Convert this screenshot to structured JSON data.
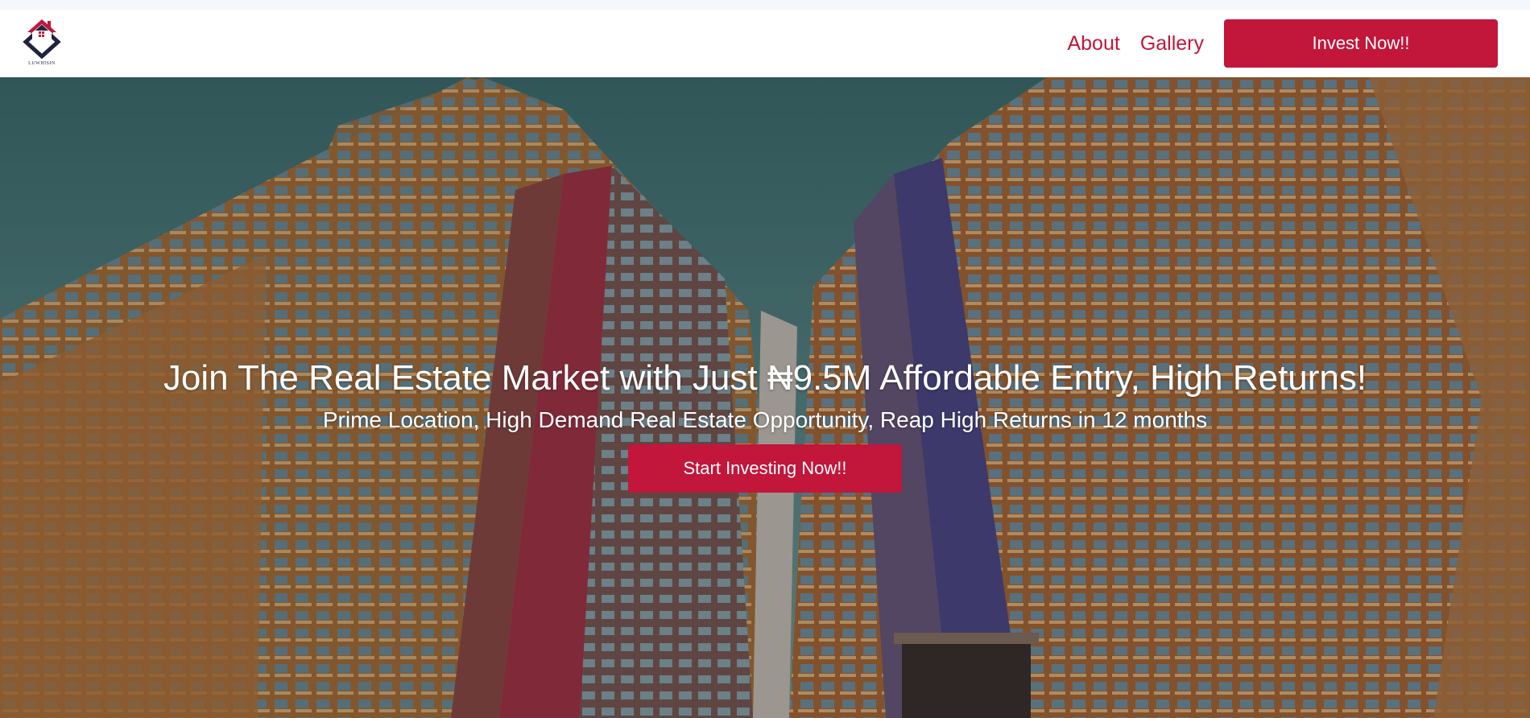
{
  "brand": {
    "logo_text": "LUWHISIN",
    "logo_icon": "house-diamond-logo"
  },
  "nav": {
    "links": [
      {
        "label": "About"
      },
      {
        "label": "Gallery"
      }
    ],
    "cta_label": "Invest Now!!"
  },
  "hero": {
    "background": "high-rise-apartment-buildings-photo",
    "title": "Join The Real Estate Market with Just ₦9.5M Affordable Entry, High Returns!",
    "subtitle": "Prime Location, High Demand Real Estate Opportunity, Reap High Returns in 12 months",
    "cta_label": "Start Investing Now!!"
  },
  "colors": {
    "accent": "#c2163b",
    "navbar_bg": "#ffffff",
    "page_bg": "#f4f7fb",
    "logo_dark": "#1f2340"
  }
}
